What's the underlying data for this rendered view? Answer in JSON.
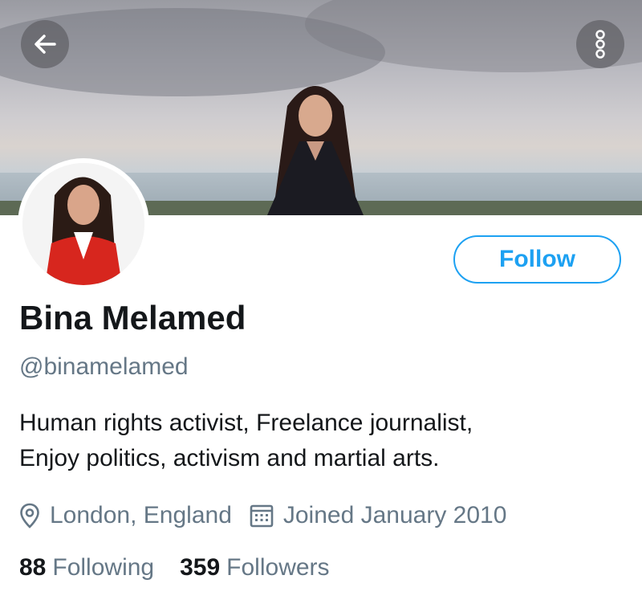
{
  "profile": {
    "name": "Bina Melamed",
    "handle": "@binamelamed",
    "bio_line1": "Human rights activist, Freelance journalist,",
    "bio_line2": "Enjoy politics, activism and martial arts.",
    "location": "London, England",
    "joined": "Joined January 2010",
    "following_count": "88",
    "following_label": "Following",
    "followers_count": "359",
    "followers_label": "Followers"
  },
  "actions": {
    "follow_label": "Follow"
  },
  "icons": {
    "back": "arrow-left-icon",
    "more": "more-vertical-icon",
    "location": "location-pin-icon",
    "calendar": "calendar-icon"
  },
  "colors": {
    "accent": "#1da1f2",
    "text_primary": "#14171a",
    "text_secondary": "#657786"
  }
}
